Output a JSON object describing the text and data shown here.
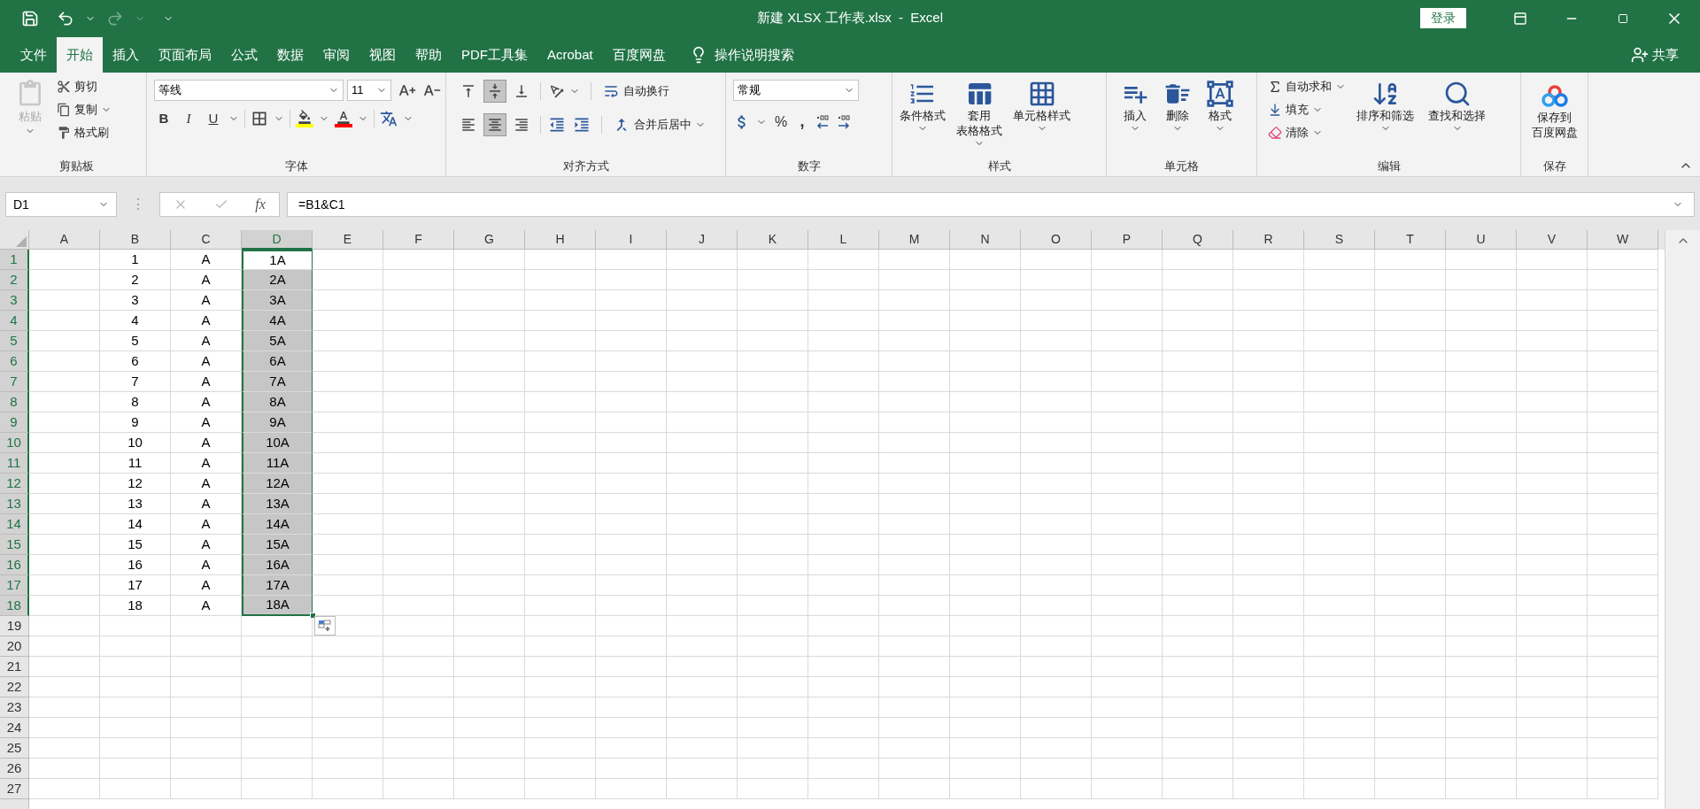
{
  "title_bar": {
    "title": "新建 XLSX 工作表.xlsx  -  Excel",
    "login": "登录"
  },
  "ribbon_tabs": [
    {
      "label": "文件",
      "selected": false
    },
    {
      "label": "开始",
      "selected": true
    },
    {
      "label": "插入",
      "selected": false
    },
    {
      "label": "页面布局",
      "selected": false
    },
    {
      "label": "公式",
      "selected": false
    },
    {
      "label": "数据",
      "selected": false
    },
    {
      "label": "审阅",
      "selected": false
    },
    {
      "label": "视图",
      "selected": false
    },
    {
      "label": "帮助",
      "selected": false
    },
    {
      "label": "PDF工具集",
      "selected": false
    },
    {
      "label": "Acrobat",
      "selected": false
    },
    {
      "label": "百度网盘",
      "selected": false
    }
  ],
  "tell_me": "操作说明搜索",
  "share": "共享",
  "clipboard": {
    "name": "剪贴板",
    "items": [
      {
        "label": "粘贴",
        "disabled": true
      },
      {
        "label": "剪切",
        "disabled": false
      },
      {
        "label": "复制",
        "disabled": false
      },
      {
        "label": "格式刷",
        "disabled": false
      }
    ]
  },
  "font": {
    "name": "字体",
    "font_name": "等线",
    "font_size": "11",
    "styles": [
      "B",
      "I",
      "U"
    ]
  },
  "alignment": {
    "name": "对齐方式",
    "vertical": [
      {
        "selected": false
      },
      {
        "selected": true
      },
      {
        "selected": false
      }
    ],
    "horizontal": [
      {
        "selected": false
      },
      {
        "selected": true
      },
      {
        "selected": false
      }
    ],
    "wrap": "自动换行",
    "merge": "合并后居中"
  },
  "number": {
    "name": "数字",
    "format": "常规",
    "percent": "%",
    "comma": ","
  },
  "styles": {
    "name": "样式",
    "items": [
      {
        "lines": [
          "条件格式"
        ]
      },
      {
        "lines": [
          "套用",
          "表格格式"
        ]
      },
      {
        "lines": [
          "单元格样式"
        ]
      }
    ]
  },
  "cells_group": {
    "name": "单元格",
    "items": [
      {
        "lines": [
          "插入"
        ]
      },
      {
        "lines": [
          "删除"
        ]
      },
      {
        "lines": [
          "格式"
        ]
      }
    ]
  },
  "editing": {
    "name": "编辑",
    "small": [
      "自动求和",
      "填充",
      "清除"
    ],
    "large": [
      {
        "lines": [
          "排序和筛选"
        ]
      },
      {
        "lines": [
          "查找和选择"
        ]
      }
    ]
  },
  "save": {
    "name": "保存",
    "lines": [
      "保存到",
      "百度网盘"
    ]
  },
  "formula_bar": {
    "name_box": "D1",
    "separator": "⋮",
    "fx": "fx",
    "formula": "=B1&C1"
  },
  "columns": [
    {
      "label": "A",
      "selected": false
    },
    {
      "label": "B",
      "selected": false
    },
    {
      "label": "C",
      "selected": false
    },
    {
      "label": "D",
      "selected": true
    },
    {
      "label": "E",
      "selected": false
    },
    {
      "label": "F",
      "selected": false
    },
    {
      "label": "G",
      "selected": false
    },
    {
      "label": "H",
      "selected": false
    },
    {
      "label": "I",
      "selected": false
    },
    {
      "label": "J",
      "selected": false
    },
    {
      "label": "K",
      "selected": false
    },
    {
      "label": "L",
      "selected": false
    },
    {
      "label": "M",
      "selected": false
    },
    {
      "label": "N",
      "selected": false
    },
    {
      "label": "O",
      "selected": false
    },
    {
      "label": "P",
      "selected": false
    },
    {
      "label": "Q",
      "selected": false
    },
    {
      "label": "R",
      "selected": false
    },
    {
      "label": "S",
      "selected": false
    },
    {
      "label": "T",
      "selected": false
    },
    {
      "label": "U",
      "selected": false
    },
    {
      "label": "V",
      "selected": false
    },
    {
      "label": "W",
      "selected": false
    }
  ],
  "rows": [
    {
      "number": "1",
      "selected": true,
      "active": true,
      "b": "1",
      "c": "A",
      "d": "1A"
    },
    {
      "number": "2",
      "selected": true,
      "active": false,
      "b": "2",
      "c": "A",
      "d": "2A"
    },
    {
      "number": "3",
      "selected": true,
      "active": false,
      "b": "3",
      "c": "A",
      "d": "3A"
    },
    {
      "number": "4",
      "selected": true,
      "active": false,
      "b": "4",
      "c": "A",
      "d": "4A"
    },
    {
      "number": "5",
      "selected": true,
      "active": false,
      "b": "5",
      "c": "A",
      "d": "5A"
    },
    {
      "number": "6",
      "selected": true,
      "active": false,
      "b": "6",
      "c": "A",
      "d": "6A"
    },
    {
      "number": "7",
      "selected": true,
      "active": false,
      "b": "7",
      "c": "A",
      "d": "7A"
    },
    {
      "number": "8",
      "selected": true,
      "active": false,
      "b": "8",
      "c": "A",
      "d": "8A"
    },
    {
      "number": "9",
      "selected": true,
      "active": false,
      "b": "9",
      "c": "A",
      "d": "9A"
    },
    {
      "number": "10",
      "selected": true,
      "active": false,
      "b": "10",
      "c": "A",
      "d": "10A"
    },
    {
      "number": "11",
      "selected": true,
      "active": false,
      "b": "11",
      "c": "A",
      "d": "11A"
    },
    {
      "number": "12",
      "selected": true,
      "active": false,
      "b": "12",
      "c": "A",
      "d": "12A"
    },
    {
      "number": "13",
      "selected": true,
      "active": false,
      "b": "13",
      "c": "A",
      "d": "13A"
    },
    {
      "number": "14",
      "selected": true,
      "active": false,
      "b": "14",
      "c": "A",
      "d": "14A"
    },
    {
      "number": "15",
      "selected": true,
      "active": false,
      "b": "15",
      "c": "A",
      "d": "15A"
    },
    {
      "number": "16",
      "selected": true,
      "active": false,
      "b": "16",
      "c": "A",
      "d": "16A"
    },
    {
      "number": "17",
      "selected": true,
      "active": false,
      "b": "17",
      "c": "A",
      "d": "17A"
    },
    {
      "number": "18",
      "selected": true,
      "active": false,
      "b": "18",
      "c": "A",
      "d": "18A"
    },
    {
      "number": "19",
      "selected": false,
      "active": false
    },
    {
      "number": "20",
      "selected": false,
      "active": false
    },
    {
      "number": "21",
      "selected": false,
      "active": false
    },
    {
      "number": "22",
      "selected": false,
      "active": false
    },
    {
      "number": "23",
      "selected": false,
      "active": false
    },
    {
      "number": "24",
      "selected": false,
      "active": false
    },
    {
      "number": "25",
      "selected": false,
      "active": false
    },
    {
      "number": "26",
      "selected": false,
      "active": false
    },
    {
      "number": "27",
      "selected": false,
      "active": false
    }
  ]
}
